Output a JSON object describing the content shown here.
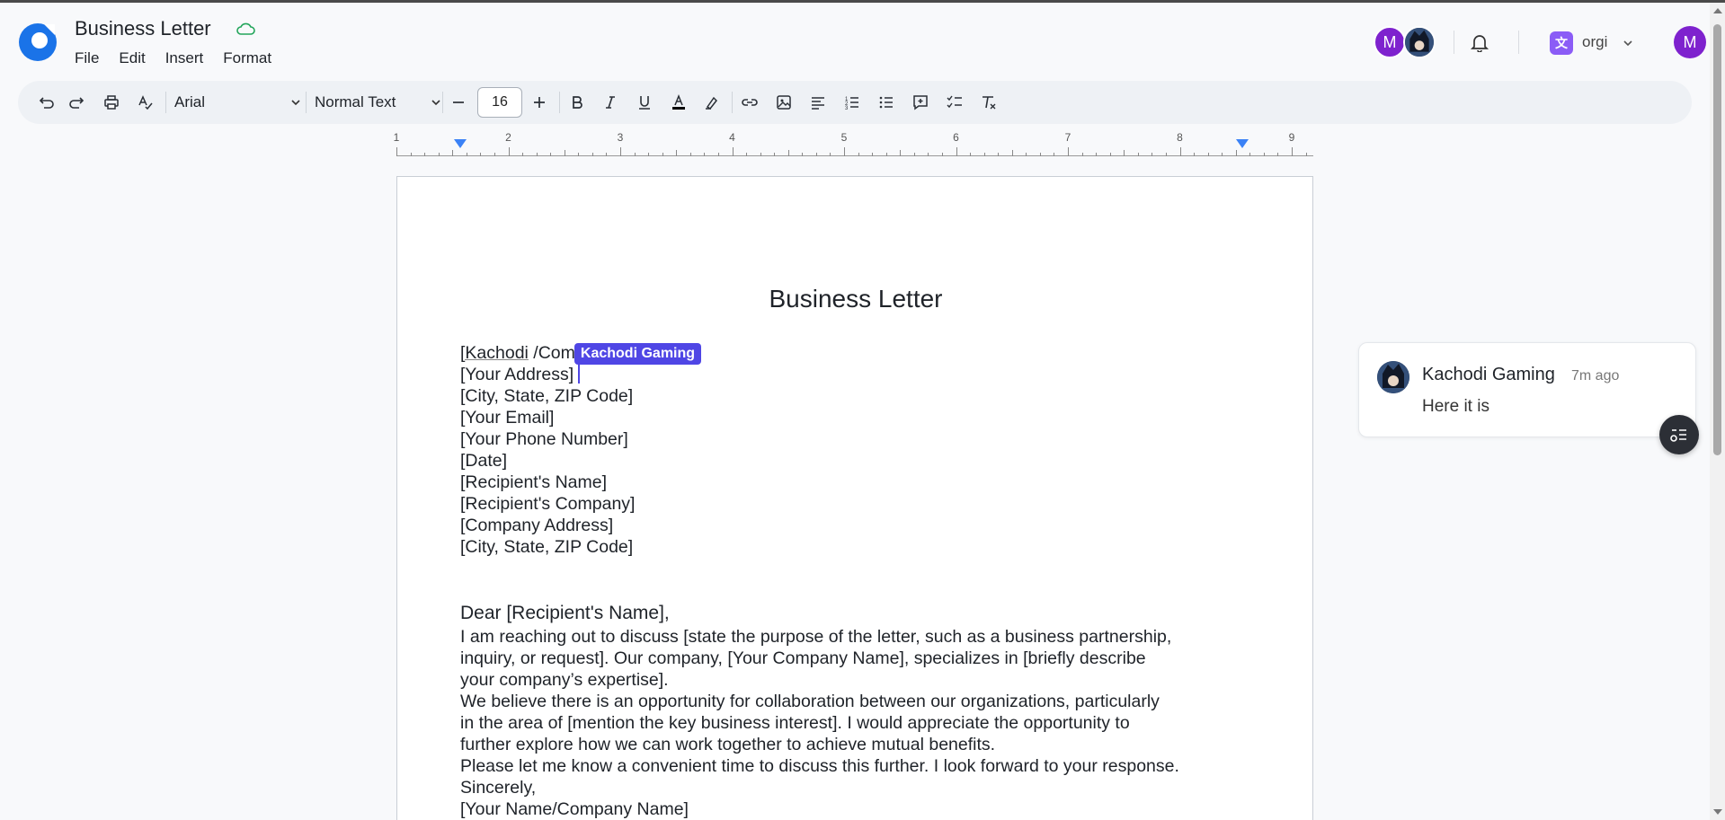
{
  "app": {
    "doc_title": "Business Letter",
    "menu": [
      "File",
      "Edit",
      "Insert",
      "Format"
    ]
  },
  "header": {
    "avatar_initial": "M",
    "org_name": "orgi",
    "org_initial": "文",
    "user_initial": "M"
  },
  "toolbar": {
    "font_family": "Arial",
    "text_style": "Normal Text",
    "font_size": "16",
    "icons": [
      "undo-icon",
      "redo-icon",
      "print-icon",
      "spellcheck-icon",
      "minus-icon",
      "plus-icon",
      "bold-icon",
      "italic-icon",
      "underline-icon",
      "text-color-icon",
      "highlight-icon",
      "link-icon",
      "image-icon",
      "align-left-icon",
      "numbered-list-icon",
      "bullet-list-icon",
      "add-comment-icon",
      "checklist-icon",
      "clear-format-icon"
    ]
  },
  "ruler": {
    "numbers": [
      "1",
      "2",
      "3",
      "4",
      "5",
      "6",
      "7",
      "8",
      "9"
    ]
  },
  "document": {
    "heading": "Business Letter",
    "first_line_word": "[Kachodi",
    "first_line_rest": " /Com",
    "collaborator_tag": "Kachodi Gaming",
    "address_lines": [
      "[Your Address]",
      "[City, State, ZIP Code]",
      "[Your Email]",
      "[Your Phone Number]",
      "[Date]",
      "[Recipient's Name]",
      "[Recipient's Company]",
      "[Company Address]",
      "[City, State, ZIP Code]"
    ],
    "greeting": "Dear [Recipient's Name],",
    "paragraphs": [
      "I am reaching out to discuss [state the purpose of the letter, such as a business partnership,",
      "inquiry, or request]. Our company, [Your Company Name], specializes in [briefly describe",
      "your company’s expertise].",
      "We believe there is an opportunity for collaboration between our organizations, particularly",
      "in the area of [mention the key business interest]. I would appreciate the opportunity to",
      "further explore how we can work together to achieve mutual benefits.",
      "Please let me know a convenient time to discuss this further. I look forward to your response.",
      "Sincerely,",
      "[Your Name/Company Name]"
    ]
  },
  "comment": {
    "author": "Kachodi Gaming",
    "time": "7m ago",
    "body": "Here it is"
  },
  "colors": {
    "accent": "#4f46e5",
    "brand": "#1a73e8",
    "avatar": "#7e22ce",
    "org": "#8b5cf6"
  }
}
